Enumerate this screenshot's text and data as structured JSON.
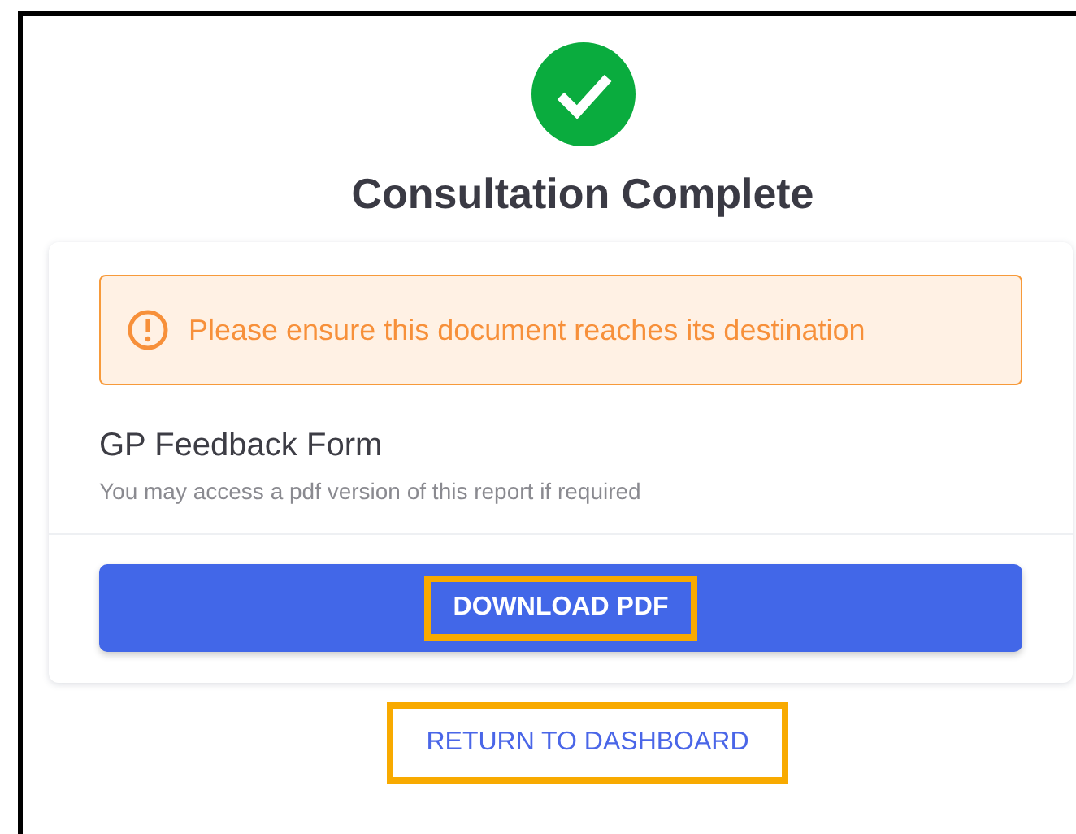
{
  "heading": "Consultation Complete",
  "alert": {
    "kind": "warning",
    "text": "Please ensure this document reaches its destination"
  },
  "document": {
    "title": "GP Feedback Form",
    "description": "You may access a pdf version of this report if required"
  },
  "download_button": {
    "label": "DOWNLOAD PDF",
    "highlighted": true
  },
  "return_link": {
    "label": "RETURN TO DASHBOARD",
    "highlighted": true
  }
}
